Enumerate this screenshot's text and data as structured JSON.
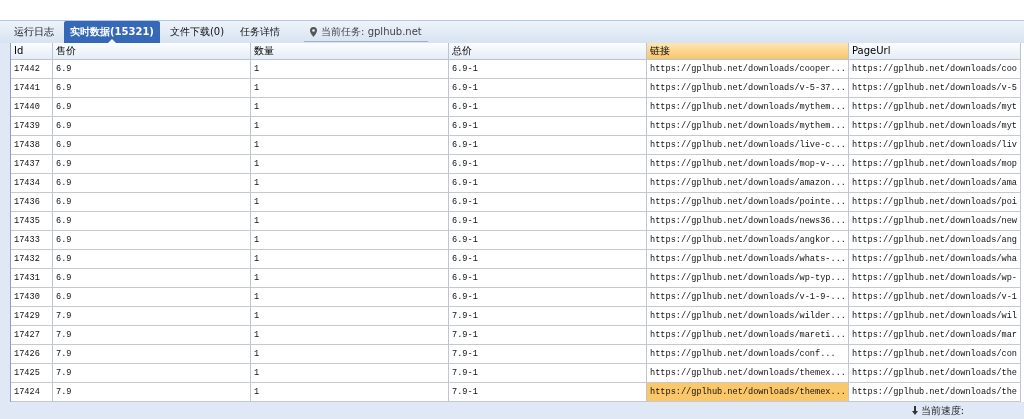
{
  "tabs": [
    {
      "label": "运行日志",
      "selected": false
    },
    {
      "label": "实时数据(15321)",
      "selected": true
    },
    {
      "label": "文件下载(0)",
      "selected": false
    },
    {
      "label": "任务详情",
      "selected": false
    }
  ],
  "current_task": {
    "label": "当前任务: gplhub.net"
  },
  "table": {
    "columns": [
      {
        "label": "Id",
        "selected": false
      },
      {
        "label": "售价",
        "selected": false
      },
      {
        "label": "数量",
        "selected": false
      },
      {
        "label": "总价",
        "selected": false
      },
      {
        "label": "链接",
        "selected": true
      },
      {
        "label": "PageUrl",
        "selected": false
      }
    ],
    "rows": [
      {
        "selected": false,
        "cells": [
          "17442",
          "6.9",
          "1",
          "6.9-1",
          "https://gplhub.net/downloads/cooper...",
          "https://gplhub.net/downloads/coo"
        ]
      },
      {
        "selected": false,
        "cells": [
          "17441",
          "6.9",
          "1",
          "6.9-1",
          "https://gplhub.net/downloads/v-5-37...",
          "https://gplhub.net/downloads/v-5"
        ]
      },
      {
        "selected": false,
        "cells": [
          "17440",
          "6.9",
          "1",
          "6.9-1",
          "https://gplhub.net/downloads/mythem...",
          "https://gplhub.net/downloads/myt"
        ]
      },
      {
        "selected": false,
        "cells": [
          "17439",
          "6.9",
          "1",
          "6.9-1",
          "https://gplhub.net/downloads/mythem...",
          "https://gplhub.net/downloads/myt"
        ]
      },
      {
        "selected": false,
        "cells": [
          "17438",
          "6.9",
          "1",
          "6.9-1",
          "https://gplhub.net/downloads/live-c...",
          "https://gplhub.net/downloads/liv"
        ]
      },
      {
        "selected": false,
        "cells": [
          "17437",
          "6.9",
          "1",
          "6.9-1",
          "https://gplhub.net/downloads/mop-v-...",
          "https://gplhub.net/downloads/mop"
        ]
      },
      {
        "selected": false,
        "cells": [
          "17434",
          "6.9",
          "1",
          "6.9-1",
          "https://gplhub.net/downloads/amazon...",
          "https://gplhub.net/downloads/ama"
        ]
      },
      {
        "selected": false,
        "cells": [
          "17436",
          "6.9",
          "1",
          "6.9-1",
          "https://gplhub.net/downloads/pointe...",
          "https://gplhub.net/downloads/poi"
        ]
      },
      {
        "selected": false,
        "cells": [
          "17435",
          "6.9",
          "1",
          "6.9-1",
          "https://gplhub.net/downloads/news36...",
          "https://gplhub.net/downloads/new"
        ]
      },
      {
        "selected": false,
        "cells": [
          "17433",
          "6.9",
          "1",
          "6.9-1",
          "https://gplhub.net/downloads/angkor...",
          "https://gplhub.net/downloads/ang"
        ]
      },
      {
        "selected": false,
        "cells": [
          "17432",
          "6.9",
          "1",
          "6.9-1",
          "https://gplhub.net/downloads/whats-...",
          "https://gplhub.net/downloads/wha"
        ]
      },
      {
        "selected": false,
        "cells": [
          "17431",
          "6.9",
          "1",
          "6.9-1",
          "https://gplhub.net/downloads/wp-typ...",
          "https://gplhub.net/downloads/wp-"
        ]
      },
      {
        "selected": false,
        "cells": [
          "17430",
          "6.9",
          "1",
          "6.9-1",
          "https://gplhub.net/downloads/v-1-9-...",
          "https://gplhub.net/downloads/v-1"
        ]
      },
      {
        "selected": false,
        "cells": [
          "17429",
          "7.9",
          "1",
          "7.9-1",
          "https://gplhub.net/downloads/wilder...",
          "https://gplhub.net/downloads/wil"
        ]
      },
      {
        "selected": false,
        "cells": [
          "17427",
          "7.9",
          "1",
          "7.9-1",
          "https://gplhub.net/downloads/mareti...",
          "https://gplhub.net/downloads/mar"
        ]
      },
      {
        "selected": false,
        "cells": [
          "17426",
          "7.9",
          "1",
          "7.9-1",
          "https://gplhub.net/downloads/conf...",
          "https://gplhub.net/downloads/con"
        ]
      },
      {
        "selected": false,
        "cells": [
          "17425",
          "7.9",
          "1",
          "7.9-1",
          "https://gplhub.net/downloads/themex...",
          "https://gplhub.net/downloads/the"
        ]
      },
      {
        "selected": true,
        "cells": [
          "17424",
          "7.9",
          "1",
          "7.9-1",
          "https://gplhub.net/downloads/themex...",
          "https://gplhub.net/downloads/the"
        ]
      }
    ]
  },
  "status_bar": {
    "speed_label": "当前速度:"
  }
}
